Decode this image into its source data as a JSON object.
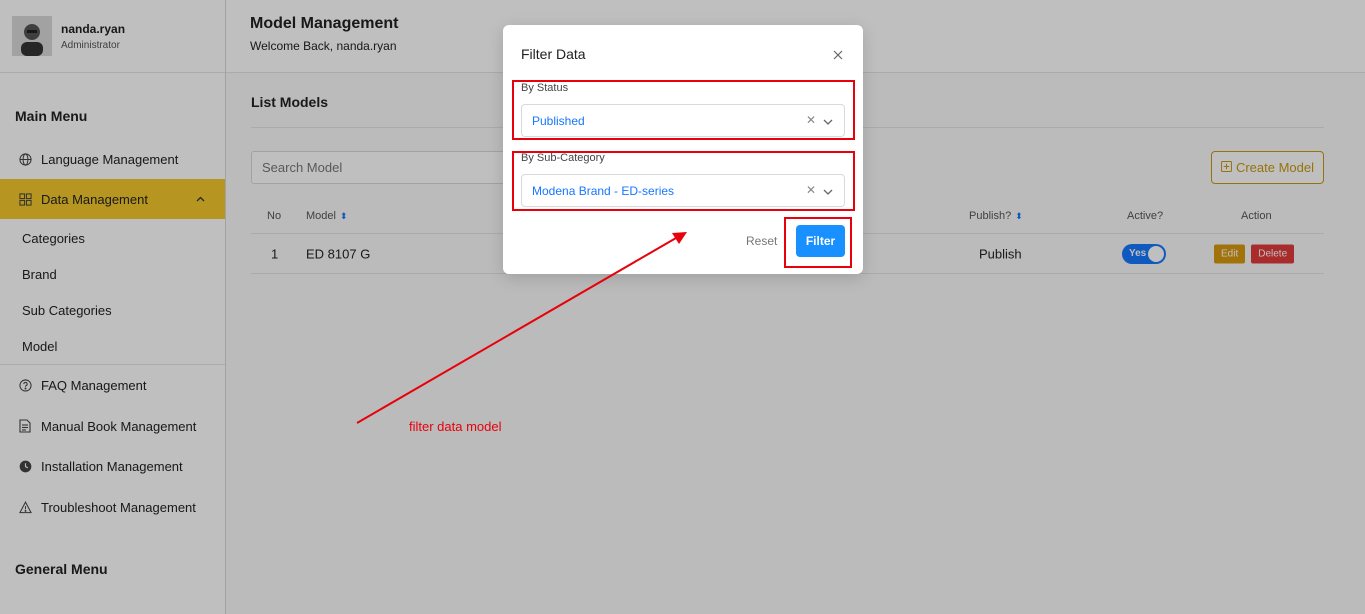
{
  "user": {
    "name": "nanda.ryan",
    "role": "Administrator"
  },
  "sidebar": {
    "main_menu_title": "Main Menu",
    "general_menu_title": "General Menu",
    "items": [
      {
        "label": "Language Management",
        "icon": "globe-icon"
      },
      {
        "label": "Data Management",
        "icon": "grid-icon"
      },
      {
        "label": "FAQ Management",
        "icon": "help-circle-icon"
      },
      {
        "label": "Manual Book Management",
        "icon": "document-icon"
      },
      {
        "label": "Installation Management",
        "icon": "clock-icon"
      },
      {
        "label": "Troubleshoot Management",
        "icon": "warning-icon"
      }
    ],
    "sub_items": [
      "Categories",
      "Brand",
      "Sub Categories",
      "Model"
    ]
  },
  "header": {
    "title": "Model Management",
    "welcome": "Welcome Back, nanda.ryan"
  },
  "list": {
    "title": "List Models",
    "search_placeholder": "Search Model",
    "create_label": "Create Model",
    "columns": {
      "no": "No",
      "model": "Model",
      "publish": "Publish?",
      "active": "Active?",
      "action": "Action"
    },
    "rows": [
      {
        "no": "1",
        "model": "ED 8107 G",
        "publish": "Publish",
        "active": "Yes"
      }
    ],
    "edit_label": "Edit",
    "delete_label": "Delete"
  },
  "modal": {
    "title": "Filter Data",
    "status_label": "By Status",
    "status_value": "Published",
    "subcategory_label": "By Sub-Category",
    "subcategory_value": "Modena Brand - ED-series",
    "reset_label": "Reset",
    "filter_label": "Filter"
  },
  "annotation": {
    "text": "filter data model",
    "color": "#e8000b"
  },
  "colors": {
    "accent": "#f3c92b",
    "primary": "#1890ff",
    "danger": "#e23b3b",
    "warning": "#d99a0f"
  }
}
